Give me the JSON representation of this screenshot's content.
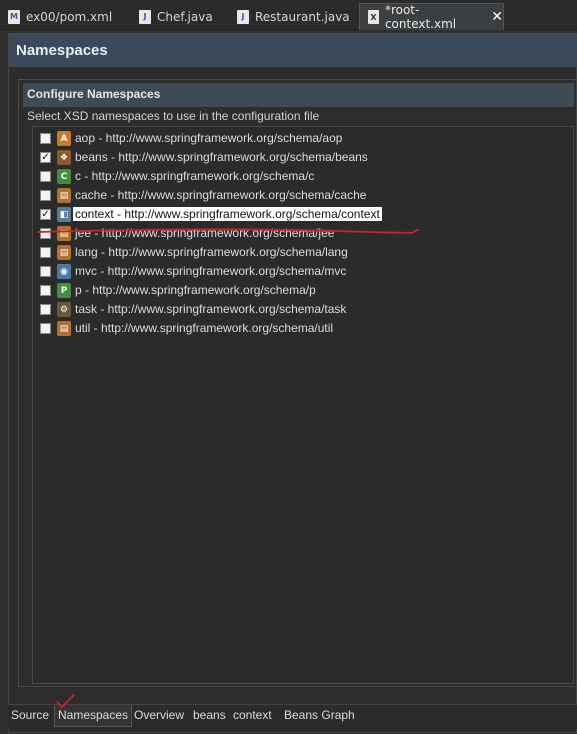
{
  "tabs": [
    {
      "label": "ex00/pom.xml",
      "icon": "maven-file-icon"
    },
    {
      "label": "Chef.java",
      "icon": "java-file-icon"
    },
    {
      "label": "Restaurant.java",
      "icon": "java-file-icon"
    },
    {
      "label": "*root-context.xml",
      "icon": "xml-file-icon",
      "active": true
    }
  ],
  "header": {
    "title": "Namespaces"
  },
  "section": {
    "title": "Configure Namespaces",
    "description": "Select XSD namespaces to use in the configuration file"
  },
  "namespaces": [
    {
      "label": "aop - http://www.springframework.org/schema/aop",
      "checked": false,
      "icon": "aop-icon",
      "glyph": "A",
      "color": "#c97a2a"
    },
    {
      "label": "beans - http://www.springframework.org/schema/beans",
      "checked": true,
      "icon": "beans-icon",
      "glyph": "❖",
      "color": "#8a5a2a"
    },
    {
      "label": "c - http://www.springframework.org/schema/c",
      "checked": false,
      "icon": "c-icon",
      "glyph": "C",
      "color": "#3f8f3f"
    },
    {
      "label": "cache - http://www.springframework.org/schema/cache",
      "checked": false,
      "icon": "cache-icon",
      "glyph": "▤",
      "color": "#b07030"
    },
    {
      "label": "context - http://www.springframework.org/schema/context",
      "checked": true,
      "icon": "context-icon",
      "glyph": "◧",
      "color": "#5a7a9a",
      "selected": true
    },
    {
      "label": "jee - http://www.springframework.org/schema/jee",
      "checked": false,
      "icon": "jee-icon",
      "glyph": "▤",
      "color": "#b07030"
    },
    {
      "label": "lang - http://www.springframework.org/schema/lang",
      "checked": false,
      "icon": "lang-icon",
      "glyph": "▤",
      "color": "#b07030"
    },
    {
      "label": "mvc - http://www.springframework.org/schema/mvc",
      "checked": false,
      "icon": "mvc-icon",
      "glyph": "◉",
      "color": "#4a7aa8"
    },
    {
      "label": "p - http://www.springframework.org/schema/p",
      "checked": false,
      "icon": "p-icon",
      "glyph": "P",
      "color": "#3f8f3f"
    },
    {
      "label": "task - http://www.springframework.org/schema/task",
      "checked": false,
      "icon": "task-icon",
      "glyph": "⚙",
      "color": "#6a5a3a"
    },
    {
      "label": "util - http://www.springframework.org/schema/util",
      "checked": false,
      "icon": "util-icon",
      "glyph": "▤",
      "color": "#b07030"
    }
  ],
  "bottom_tabs": [
    {
      "label": "Source"
    },
    {
      "label": "Namespaces",
      "active": true
    },
    {
      "label": "Overview"
    },
    {
      "label": "beans"
    },
    {
      "label": "context"
    },
    {
      "label": "Beans Graph"
    }
  ],
  "colors": {
    "annotation": "#d42020",
    "header_bg": "#3a4a5a",
    "selection_bg": "#ffffff"
  }
}
